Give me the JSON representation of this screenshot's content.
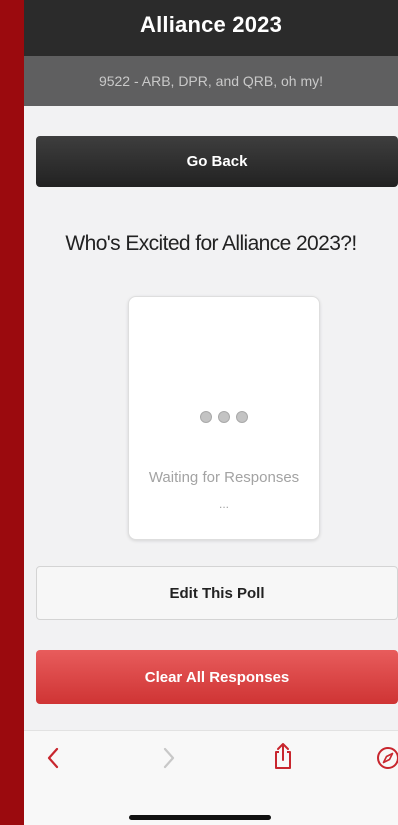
{
  "header": {
    "title": "Alliance 2023"
  },
  "subheader": {
    "text": "9522 - ARB, DPR, and QRB, oh my!"
  },
  "buttons": {
    "go_back": "Go Back",
    "edit_poll": "Edit This Poll",
    "clear_responses": "Clear All Responses"
  },
  "poll": {
    "question": "Who's Excited for Alliance 2023?!",
    "status": "Waiting for Responses",
    "status_ellipsis": "..."
  },
  "toolbar": {
    "icons": [
      "back-icon",
      "forward-icon",
      "share-icon",
      "compass-icon"
    ]
  },
  "colors": {
    "frame": "#9b0a0e",
    "header_bg": "#2b2b2b",
    "subheader_bg": "#5f5f60",
    "clear_button": "#d94343",
    "accent_icon": "#c8262e"
  }
}
